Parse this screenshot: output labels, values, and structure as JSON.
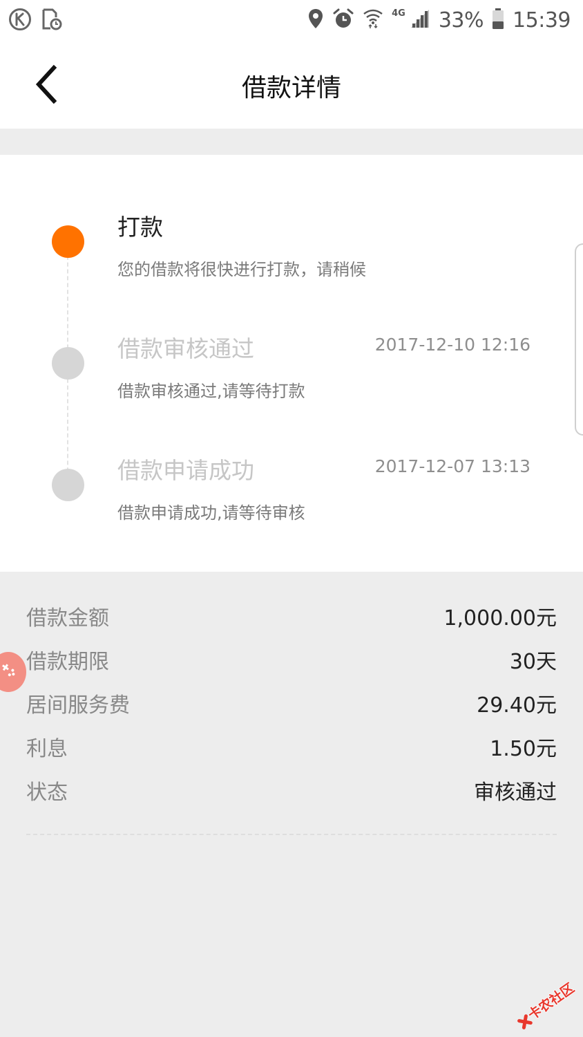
{
  "status_bar": {
    "network_type": "4G",
    "battery_percent": "33%",
    "time": "15:39",
    "icons": [
      "k-circle-icon",
      "file-clock-icon",
      "location-icon",
      "alarm-icon",
      "wifi-icon",
      "signal-icon",
      "battery-icon"
    ]
  },
  "header": {
    "title": "借款详情",
    "back_icon": "chevron-left-icon"
  },
  "timeline": [
    {
      "title": "打款",
      "time": "",
      "description": "您的借款将很快进行打款，请稍候",
      "active": true
    },
    {
      "title": "借款审核通过",
      "time": "2017-12-10 12:16",
      "description": "借款审核通过,请等待打款",
      "active": false
    },
    {
      "title": "借款申请成功",
      "time": "2017-12-07 13:13",
      "description": "借款申请成功,请等待审核",
      "active": false
    }
  ],
  "details": [
    {
      "label": "借款金额",
      "value": "1,000.00元"
    },
    {
      "label": "借款期限",
      "value": "30天"
    },
    {
      "label": "居间服务费",
      "value": "29.40元"
    },
    {
      "label": "利息",
      "value": "1.50元"
    },
    {
      "label": "状态",
      "value": "审核通过"
    }
  ],
  "colors": {
    "accent": "#ff7200",
    "inactive_dot": "#d6d6d6",
    "page_background": "#ededed",
    "card_background": "#ffffff",
    "float_button": "#f38f84",
    "watermark_red": "#e8372c"
  },
  "watermark": {
    "text": "卡农社区"
  }
}
